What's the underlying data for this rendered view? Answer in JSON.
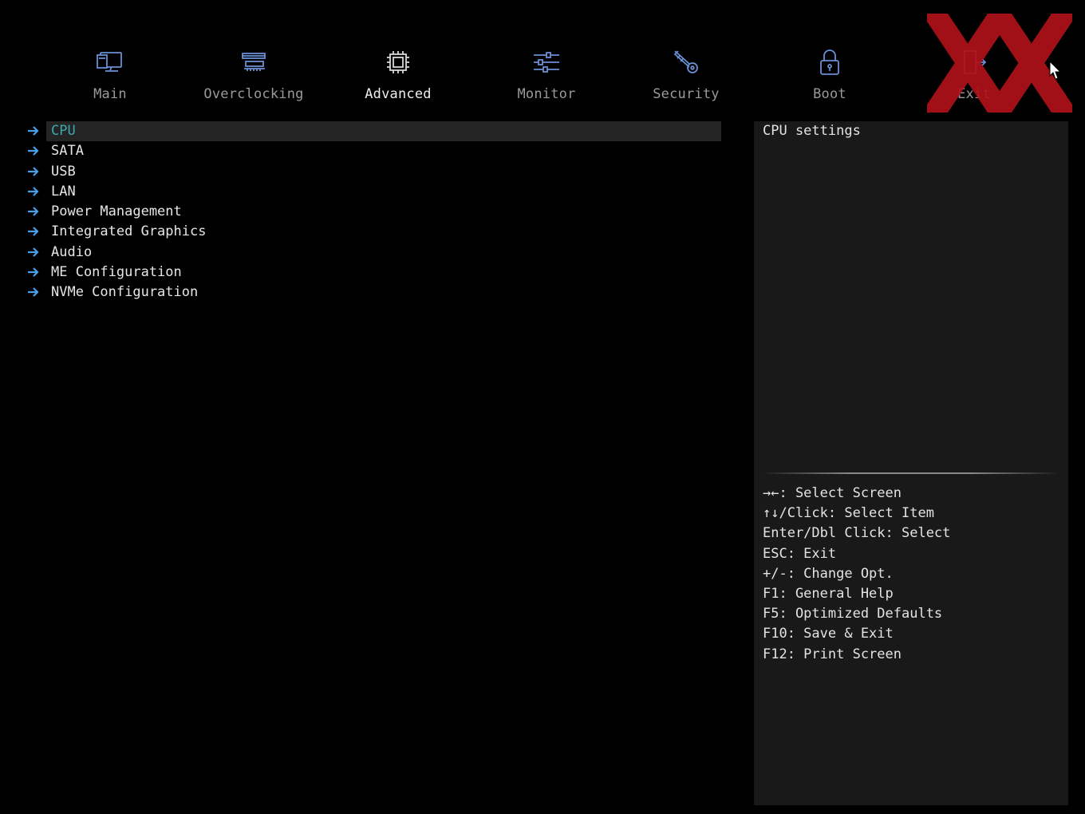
{
  "tabs": [
    {
      "label": "Main",
      "icon": "computer-icon",
      "active": false
    },
    {
      "label": "Overclocking",
      "icon": "memory-module-icon",
      "active": false
    },
    {
      "label": "Advanced",
      "icon": "cpu-chip-icon",
      "active": true
    },
    {
      "label": "Monitor",
      "icon": "sliders-icon",
      "active": false
    },
    {
      "label": "Security",
      "icon": "key-icon",
      "active": false
    },
    {
      "label": "Boot",
      "icon": "padlock-icon",
      "active": false
    },
    {
      "label": "Exit",
      "icon": "exit-door-icon",
      "active": false
    }
  ],
  "menu": {
    "items": [
      {
        "label": "CPU",
        "selected": true
      },
      {
        "label": "SATA"
      },
      {
        "label": "USB"
      },
      {
        "label": "LAN"
      },
      {
        "label": "Power Management"
      },
      {
        "label": "Integrated Graphics"
      },
      {
        "label": "Audio"
      },
      {
        "label": "ME Configuration"
      },
      {
        "label": "NVMe Configuration"
      }
    ]
  },
  "help": {
    "description": "CPU settings",
    "keys": [
      "→←: Select Screen",
      "↑↓/Click: Select Item",
      "Enter/Dbl Click: Select",
      "ESC: Exit",
      "+/-: Change Opt.",
      "F1: General Help",
      "F5: Optimized Defaults",
      "F10: Save & Exit",
      "F12: Print Screen"
    ]
  },
  "colors": {
    "background": "#000000",
    "panel": "#191919",
    "accent_selected_text": "#3ea8b0",
    "icon_blue": "#6a8fd4",
    "logo_red": "#b0121a"
  }
}
